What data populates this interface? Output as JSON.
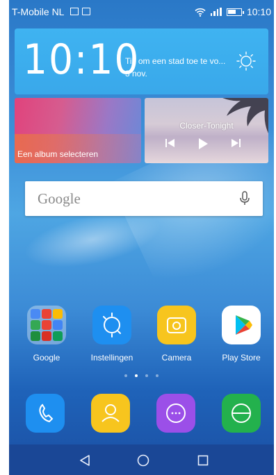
{
  "status_bar": {
    "carrier": "T-Mobile NL",
    "time": "10:10",
    "icons": [
      "image-icon",
      "keyboard-icon",
      "wifi-icon",
      "signal-icon",
      "battery-icon"
    ]
  },
  "clock_widget": {
    "time": "10:10",
    "city_prompt": "Tik om een stad toe te vo...",
    "date": "3 nov.",
    "weather_icon": "sun-icon"
  },
  "album_widget": {
    "label": "Een album selecteren"
  },
  "music_widget": {
    "title": "Closer-Tonight",
    "controls": [
      "previous-icon",
      "play-icon",
      "next-icon"
    ]
  },
  "search": {
    "logo": "Google",
    "icon": "mic-icon"
  },
  "apps": [
    {
      "label": "Google",
      "icon": "google-folder-icon"
    },
    {
      "label": "Instellingen",
      "icon": "settings-icon"
    },
    {
      "label": "Camera",
      "icon": "camera-icon"
    },
    {
      "label": "Play Store",
      "icon": "play-store-icon"
    }
  ],
  "page_indicator": {
    "count": 4,
    "active": 1
  },
  "dock": [
    {
      "icon": "phone-icon",
      "color": "#1e8ff0"
    },
    {
      "icon": "contacts-icon",
      "color": "#f7c51e"
    },
    {
      "icon": "messages-icon",
      "color": "#9b4fe8"
    },
    {
      "icon": "browser-icon",
      "color": "#23b14d"
    }
  ],
  "nav_bar": [
    "back-icon",
    "home-icon",
    "recents-icon"
  ]
}
